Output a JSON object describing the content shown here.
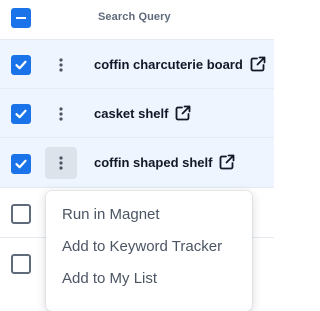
{
  "header": {
    "column_label": "Search Query",
    "select_all_state": "indeterminate"
  },
  "rows": [
    {
      "query": "coffin charcuterie board",
      "checked": true
    },
    {
      "query": "casket shelf",
      "checked": true
    },
    {
      "query": "coffin shaped shelf",
      "checked": true
    },
    {
      "query": "",
      "checked": false
    },
    {
      "query": "",
      "checked": false
    }
  ],
  "menu": {
    "items": [
      {
        "label": "Run in Magnet"
      },
      {
        "label": "Add to Keyword Tracker"
      },
      {
        "label": "Add to My List"
      }
    ]
  },
  "colors": {
    "accent": "#1a73e8",
    "selected_row_bg": "#eef5ff",
    "active_button_bg": "#dde3ea"
  },
  "icons": {
    "row_actions": "more-vertical-icon",
    "external": "external-link-icon",
    "check": "check-icon",
    "indeterminate": "minus-icon"
  }
}
